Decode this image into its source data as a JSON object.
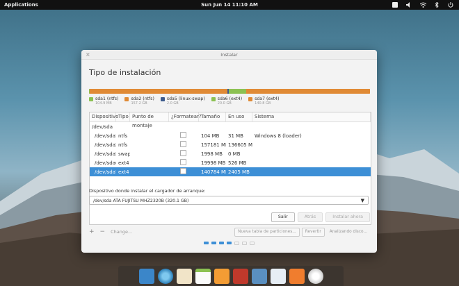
{
  "topbar": {
    "applications": "Applications",
    "clock": "Sun Jun 14   11:10 AM"
  },
  "window": {
    "title": "Instalar",
    "heading": "Tipo de instalación"
  },
  "partitions": [
    {
      "name": "sda1 (ntfs)",
      "size": "104.9 MB",
      "color": "#8cc152",
      "fraction": 0.0006
    },
    {
      "name": "sda2 (ntfs)",
      "size": "157.2 GB",
      "color": "#e08a35",
      "fraction": 0.49
    },
    {
      "name": "sda5 (linux-swap)",
      "size": "2.0 GB",
      "color": "#3c5b8d",
      "fraction": 0.006
    },
    {
      "name": "sda6 (ext4)",
      "size": "20.0 GB",
      "color": "#8cc152",
      "fraction": 0.062
    },
    {
      "name": "sda7 (ext4)",
      "size": "140.8 GB",
      "color": "#e08a35",
      "fraction": 0.44
    }
  ],
  "table": {
    "headers": [
      "Dispositivo",
      "Tipo",
      "Punto de montaje",
      "¿Formatear?",
      "Tamaño",
      "En uso",
      "Sistema"
    ],
    "device": "/dev/sda",
    "rows": [
      {
        "dev": "/dev/sda1",
        "type": "ntfs",
        "mount": "",
        "size": "104 MB",
        "used": "31 MB",
        "system": "Windows 8 (loader)",
        "selected": false
      },
      {
        "dev": "/dev/sda2",
        "type": "ntfs",
        "mount": "",
        "size": "157181 MB",
        "used": "136605 MB",
        "system": "",
        "selected": false
      },
      {
        "dev": "/dev/sda5",
        "type": "swap",
        "mount": "",
        "size": "1998 MB",
        "used": "0 MB",
        "system": "",
        "selected": false
      },
      {
        "dev": "/dev/sda6",
        "type": "ext4",
        "mount": "",
        "size": "19998 MB",
        "used": "526 MB",
        "system": "",
        "selected": false
      },
      {
        "dev": "/dev/sda7",
        "type": "ext4",
        "mount": "",
        "size": "140784 MB",
        "used": "2405 MB",
        "system": "",
        "selected": true
      }
    ]
  },
  "tools": {
    "add": "+",
    "remove": "−",
    "change": "Change...",
    "new_table": "Nueva tabla de particiones...",
    "revert": "Revertir",
    "advanced": "Analizando disco..."
  },
  "boot": {
    "label": "Dispositivo donde instalar el cargador de arranque:",
    "value": "/dev/sda   ATA FUJITSU MHZ2320B (320.1 GB)"
  },
  "buttons": {
    "quit": "Salir",
    "back": "Atrás",
    "install": "Instalar ahora"
  },
  "dock_apps": [
    "files-icon",
    "browser-icon",
    "mail-icon",
    "calendar-icon",
    "music-icon",
    "video-icon",
    "photos-icon",
    "settings-icon",
    "appcenter-icon",
    "installer-icon"
  ]
}
